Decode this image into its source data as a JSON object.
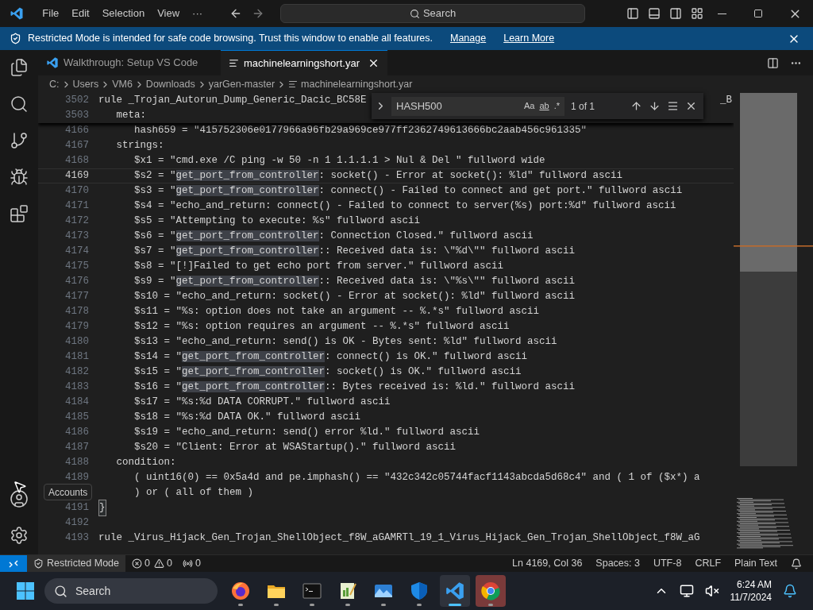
{
  "title_bar": {
    "menu": [
      "File",
      "Edit",
      "Selection",
      "View",
      "···"
    ],
    "search": {
      "placeholder": "Search"
    }
  },
  "banner": {
    "message": "Restricted Mode is intended for safe code browsing. Trust this window to enable all features.",
    "links": [
      "Manage",
      "Learn More"
    ]
  },
  "tooltip": "Accounts",
  "tabs": [
    {
      "label": "Walkthrough: Setup VS Code",
      "selected": false,
      "kind": "walkthrough"
    },
    {
      "label": "machinelearningshort.yar",
      "selected": true,
      "kind": "file"
    }
  ],
  "breadcrumbs": [
    "C:",
    "Users",
    "VM6",
    "Downloads",
    "yarGen-master",
    "machinelearningshort.yar"
  ],
  "sticky_lines": [
    {
      "number": "3502",
      "text": "rule _Trojan_Autorun_Dump_Generic_Dacic_BC58E",
      "tail": "_B"
    },
    {
      "number": "3503",
      "text": "   meta:"
    }
  ],
  "find_widget": {
    "value": "HASH500",
    "options": [
      "Aa",
      "ab",
      ".*"
    ],
    "result": "1 of 1"
  },
  "lines": [
    {
      "number": "4166",
      "current": false,
      "bracket_match": false,
      "segments": [
        {
          "text": "      hash659 = \"415752306e0177966a96fb29a969ce977ff2362749613666bc2aab456c961335\"",
          "highlight": false
        }
      ]
    },
    {
      "number": "4167",
      "current": false,
      "bracket_match": false,
      "segments": [
        {
          "text": "   strings:",
          "highlight": false
        }
      ]
    },
    {
      "number": "4168",
      "current": false,
      "bracket_match": false,
      "segments": [
        {
          "text": "      $x1 = \"cmd.exe /C ping -w 50 -n 1 1.1.1.1 > Nul & Del \" fullword wide",
          "highlight": false
        }
      ]
    },
    {
      "number": "4169",
      "current": true,
      "bracket_match": false,
      "segments": [
        {
          "text": "      $s2 = \"",
          "highlight": false
        },
        {
          "text": "get_port_from_controller",
          "highlight": true
        },
        {
          "text": ": socket() - Error at socket(): %ld\" fullword ascii",
          "highlight": false
        }
      ]
    },
    {
      "number": "4170",
      "current": false,
      "bracket_match": false,
      "segments": [
        {
          "text": "      $s3 = \"",
          "highlight": false
        },
        {
          "text": "get_port_from_controller",
          "highlight": true
        },
        {
          "text": ": connect() - Failed to connect and get port.\" fullword ascii",
          "highlight": false
        }
      ]
    },
    {
      "number": "4171",
      "current": false,
      "bracket_match": false,
      "segments": [
        {
          "text": "      $s4 = \"echo_and_return: connect() - Failed to connect to server(%s) port:%d\" fullword ascii",
          "highlight": false
        }
      ]
    },
    {
      "number": "4172",
      "current": false,
      "bracket_match": false,
      "segments": [
        {
          "text": "      $s5 = \"Attempting to execute: %s\" fullword ascii",
          "highlight": false
        }
      ]
    },
    {
      "number": "4173",
      "current": false,
      "bracket_match": false,
      "segments": [
        {
          "text": "      $s6 = \"",
          "highlight": false
        },
        {
          "text": "get_port_from_controller",
          "highlight": true
        },
        {
          "text": ": Connection Closed.\" fullword ascii",
          "highlight": false
        }
      ]
    },
    {
      "number": "4174",
      "current": false,
      "bracket_match": false,
      "segments": [
        {
          "text": "      $s7 = \"",
          "highlight": false
        },
        {
          "text": "get_port_from_controller",
          "highlight": true
        },
        {
          "text": ":: Received data is: \\\"%d\\\"\" fullword ascii",
          "highlight": false
        }
      ]
    },
    {
      "number": "4175",
      "current": false,
      "bracket_match": false,
      "segments": [
        {
          "text": "      $s8 = \"[!]Failed to get echo port from server.\" fullword ascii",
          "highlight": false
        }
      ]
    },
    {
      "number": "4176",
      "current": false,
      "bracket_match": false,
      "segments": [
        {
          "text": "      $s9 = \"",
          "highlight": false
        },
        {
          "text": "get_port_from_controller",
          "highlight": true
        },
        {
          "text": ":: Received data is: \\\"%s\\\"\" fullword ascii",
          "highlight": false
        }
      ]
    },
    {
      "number": "4177",
      "current": false,
      "bracket_match": false,
      "segments": [
        {
          "text": "      $s10 = \"echo_and_return: socket() - Error at socket(): %ld\" fullword ascii",
          "highlight": false
        }
      ]
    },
    {
      "number": "4178",
      "current": false,
      "bracket_match": false,
      "segments": [
        {
          "text": "      $s11 = \"%s: option does not take an argument -- %.*s\" fullword ascii",
          "highlight": false
        }
      ]
    },
    {
      "number": "4179",
      "current": false,
      "bracket_match": false,
      "segments": [
        {
          "text": "      $s12 = \"%s: option requires an argument -- %.*s\" fullword ascii",
          "highlight": false
        }
      ]
    },
    {
      "number": "4180",
      "current": false,
      "bracket_match": false,
      "segments": [
        {
          "text": "      $s13 = \"echo_and_return: send() is OK - Bytes sent: %ld\" fullword ascii",
          "highlight": false
        }
      ]
    },
    {
      "number": "4181",
      "current": false,
      "bracket_match": false,
      "segments": [
        {
          "text": "      $s14 = \"",
          "highlight": false
        },
        {
          "text": "get_port_from_controller",
          "highlight": true
        },
        {
          "text": ": connect() is OK.\" fullword ascii",
          "highlight": false
        }
      ]
    },
    {
      "number": "4182",
      "current": false,
      "bracket_match": false,
      "segments": [
        {
          "text": "      $s15 = \"",
          "highlight": false
        },
        {
          "text": "get_port_from_controller",
          "highlight": true
        },
        {
          "text": ": socket() is OK.\" fullword ascii",
          "highlight": false
        }
      ]
    },
    {
      "number": "4183",
      "current": false,
      "bracket_match": false,
      "segments": [
        {
          "text": "      $s16 = \"",
          "highlight": false
        },
        {
          "text": "get_port_from_controller",
          "highlight": true
        },
        {
          "text": ":: Bytes received is: %ld.\" fullword ascii",
          "highlight": false
        }
      ]
    },
    {
      "number": "4184",
      "current": false,
      "bracket_match": false,
      "segments": [
        {
          "text": "      $s17 = \"%s:%d DATA CORRUPT.\" fullword ascii",
          "highlight": false
        }
      ]
    },
    {
      "number": "4185",
      "current": false,
      "bracket_match": false,
      "segments": [
        {
          "text": "      $s18 = \"%s:%d DATA OK.\" fullword ascii",
          "highlight": false
        }
      ]
    },
    {
      "number": "4186",
      "current": false,
      "bracket_match": false,
      "segments": [
        {
          "text": "      $s19 = \"echo_and_return: send() error %ld.\" fullword ascii",
          "highlight": false
        }
      ]
    },
    {
      "number": "4187",
      "current": false,
      "bracket_match": false,
      "segments": [
        {
          "text": "      $s20 = \"Client: Error at WSAStartup().\" fullword ascii",
          "highlight": false
        }
      ]
    },
    {
      "number": "4188",
      "current": false,
      "bracket_match": false,
      "segments": [
        {
          "text": "   condition:",
          "highlight": false
        }
      ]
    },
    {
      "number": "4189",
      "current": false,
      "bracket_match": false,
      "segments": [
        {
          "text": "      ( uint16(0) == 0x5a4d and pe.imphash() == \"432c342c05744facf1143abcda5d68c4\" and ( 1 of ($x*) a",
          "highlight": false
        }
      ]
    },
    {
      "current": false,
      "bracket_match": false,
      "segments": [
        {
          "text": "      ) or ( all of them )",
          "highlight": false
        }
      ]
    },
    {
      "number": "4191",
      "current": false,
      "bracket_match": true,
      "segments": [
        {
          "text": "}",
          "highlight": false
        }
      ]
    },
    {
      "number": "4192",
      "current": false,
      "bracket_match": false
    },
    {
      "number": "4193",
      "current": false,
      "bracket_match": false,
      "segments": [
        {
          "text": "rule _Virus_Hijack_Gen_Trojan_ShellObject_f8W_aGAMRTl_19_1_Virus_Hijack_Gen_Trojan_ShellObject_f8W_aG",
          "highlight": false
        }
      ]
    }
  ],
  "status_bar": {
    "mode": "Restricted Mode",
    "errors": "0",
    "warnings": "0",
    "ports": "0",
    "items": [
      "Ln 4169, Col 36",
      "Spaces: 3",
      "UTF-8",
      "CRLF",
      "Plain Text"
    ]
  },
  "taskbar": {
    "search": "Search",
    "apps": [
      {
        "kind": "firefox",
        "active": false,
        "hovered": false
      },
      {
        "kind": "folder",
        "active": false,
        "hovered": false
      },
      {
        "kind": "terminal",
        "active": false,
        "hovered": false
      },
      {
        "kind": "notepad",
        "active": false,
        "hovered": false
      },
      {
        "kind": "photos",
        "active": false,
        "hovered": false
      },
      {
        "kind": "shield",
        "active": false,
        "hovered": false
      },
      {
        "kind": "vscode",
        "active": true,
        "hovered": false
      },
      {
        "kind": "chrome",
        "active": false,
        "hovered": true
      }
    ],
    "time": "6:24 AM",
    "date": "11/7/2024"
  }
}
